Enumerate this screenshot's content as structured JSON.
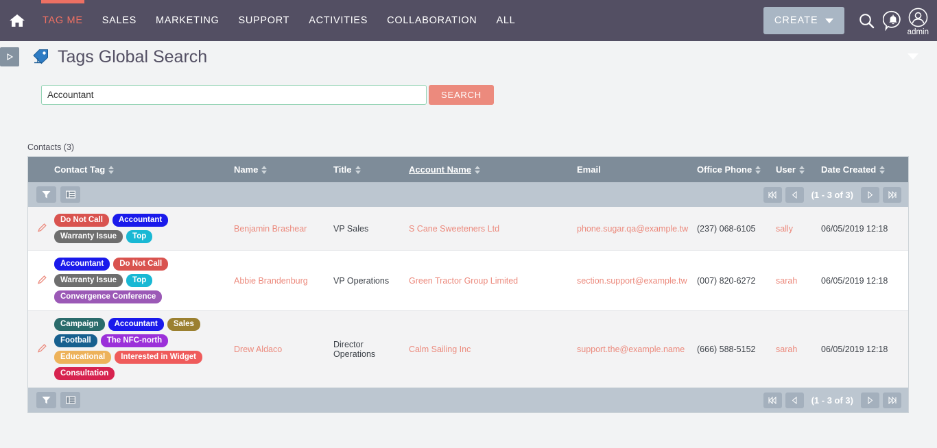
{
  "topnav": {
    "home_icon": "home-icon",
    "items": [
      {
        "label": "TAG ME",
        "active": true
      },
      {
        "label": "SALES",
        "active": false
      },
      {
        "label": "MARKETING",
        "active": false
      },
      {
        "label": "SUPPORT",
        "active": false
      },
      {
        "label": "ACTIVITIES",
        "active": false
      },
      {
        "label": "COLLABORATION",
        "active": false
      },
      {
        "label": "ALL",
        "active": false
      }
    ],
    "create_label": "CREATE",
    "search_icon": "search-icon",
    "notification_icon": "notification-bell-icon",
    "avatar_icon": "user-avatar-icon",
    "avatar_name": "admin"
  },
  "titlebar": {
    "toggle_icon": "sidebar-toggle-icon",
    "tag_icon": "tag-icon",
    "title": "Tags Global Search",
    "collapse_caret": "chevron-down-icon"
  },
  "search": {
    "value": "Accountant",
    "placeholder": "",
    "button_label": "SEARCH"
  },
  "results": {
    "heading": "Contacts (3)",
    "columns": [
      {
        "label": "Contact Tag",
        "sortable": true,
        "underline": false
      },
      {
        "label": "Name",
        "sortable": true,
        "underline": false
      },
      {
        "label": "Title",
        "sortable": true,
        "underline": false
      },
      {
        "label": "Account Name ",
        "sortable": true,
        "underline": true
      },
      {
        "label": "Email",
        "sortable": false,
        "underline": false
      },
      {
        "label": "Office Phone",
        "sortable": true,
        "underline": false
      },
      {
        "label": "User",
        "sortable": true,
        "underline": false
      },
      {
        "label": "Date Created",
        "sortable": true,
        "underline": false
      }
    ],
    "toolbar": {
      "filter_icon": "filter-funnel-icon",
      "columns_icon": "column-chooser-icon",
      "first_icon": "first-page-icon",
      "prev_icon": "previous-page-icon",
      "page_label": "(1 - 3 of 3)",
      "next_icon": "next-page-icon",
      "last_icon": "last-page-icon"
    },
    "rows": [
      {
        "tags": [
          {
            "label": "Do Not Call",
            "color": "#d9534f"
          },
          {
            "label": "Accountant",
            "color": "#1a1aeb"
          },
          {
            "label": "Warranty Issue",
            "color": "#6e6e6e"
          },
          {
            "label": "Top",
            "color": "#19b8d4"
          }
        ],
        "name": "Benjamin Brashear",
        "title": "VP Sales",
        "account": "S Cane Sweeteners Ltd",
        "email": "phone.sugar.qa@example.tw",
        "phone": "(237) 068-6105",
        "user": "sally",
        "date": "06/05/2019 12:18"
      },
      {
        "tags": [
          {
            "label": "Accountant",
            "color": "#1a1aeb"
          },
          {
            "label": "Do Not Call",
            "color": "#d9534f"
          },
          {
            "label": "Warranty Issue",
            "color": "#6e6e6e"
          },
          {
            "label": "Top",
            "color": "#19b8d4"
          },
          {
            "label": "Convergence Conference",
            "color": "#9b59b6"
          }
        ],
        "name": "Abbie Brandenburg",
        "title": "VP Operations",
        "account": "Green Tractor Group Limited",
        "email": "section.support@example.tw",
        "phone": "(007) 820-6272",
        "user": "sarah",
        "date": "06/05/2019 12:18"
      },
      {
        "tags": [
          {
            "label": "Campaign",
            "color": "#2a6b6b"
          },
          {
            "label": "Accountant",
            "color": "#1a1aeb"
          },
          {
            "label": "Sales",
            "color": "#9b8030"
          },
          {
            "label": "Football",
            "color": "#17608f"
          },
          {
            "label": "The NFC-north",
            "color": "#9b30d9"
          },
          {
            "label": "Educational",
            "color": "#edb25a"
          },
          {
            "label": "Interested in Widget",
            "color": "#ef5b5b"
          },
          {
            "label": "Consultation",
            "color": "#d7234f"
          }
        ],
        "name": "Drew Aldaco",
        "title": "Director Operations",
        "account": "Calm Sailing Inc",
        "email": "support.the@example.name",
        "phone": "(666) 588-5152",
        "user": "sarah",
        "date": "06/05/2019 12:18"
      }
    ],
    "edit_icon": "edit-pencil-icon"
  },
  "colors": {
    "nav_bg": "#534f63",
    "accent": "#ec7063",
    "header_bg": "#7e8c99",
    "toolbar_bg": "#bcc6d0"
  }
}
